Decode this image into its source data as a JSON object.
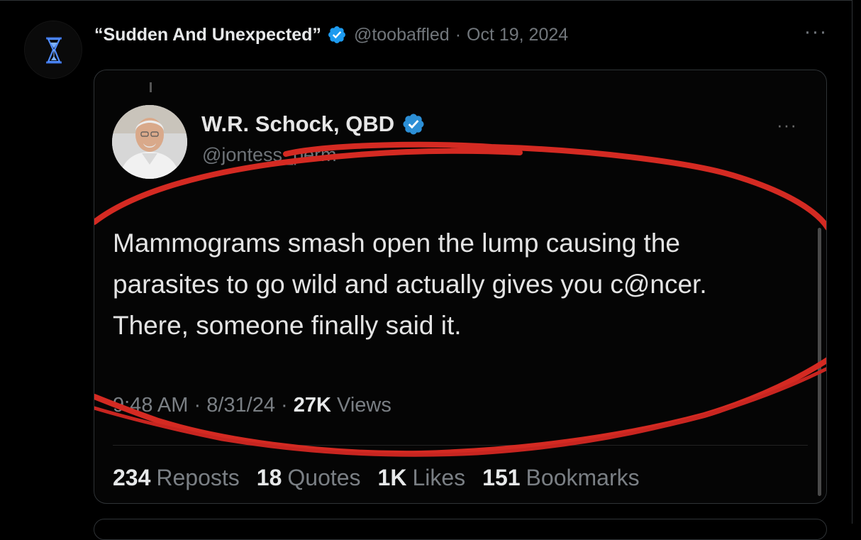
{
  "post": {
    "display_name": "“Sudden And Unexpected”",
    "handle": "@toobaffled",
    "separator": "·",
    "date": "Oct 19, 2024",
    "more_label": "···"
  },
  "quoted_screenshot": {
    "display_name": "W.R. Schock, QBD",
    "handle": "@jontess_perm",
    "more_label": "···",
    "body_lines": [
      "Mammograms smash open the lump causing the",
      "parasites to go wild and actually gives you c@ncer.",
      "There, someone finally said it."
    ],
    "meta": {
      "time": "9:48 AM",
      "sep1": "·",
      "date": "8/31/24",
      "sep2": "·",
      "views_count": "27K",
      "views_label": "Views"
    },
    "stats": [
      {
        "count": "234",
        "label": "Reposts"
      },
      {
        "count": "18",
        "label": "Quotes"
      },
      {
        "count": "1K",
        "label": "Likes"
      },
      {
        "count": "151",
        "label": "Bookmarks"
      }
    ]
  },
  "colors": {
    "background": "#000000",
    "verified_blue": "#1d9bf0",
    "secondary_text": "#71767b",
    "annotation_red": "#d42a22"
  },
  "icons": {
    "author_avatar": "hourglass-icon",
    "verified": "verified-badge-icon"
  }
}
